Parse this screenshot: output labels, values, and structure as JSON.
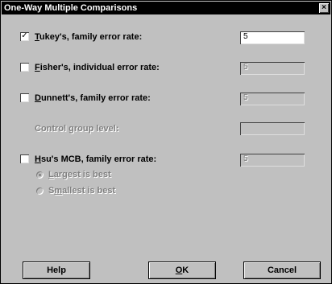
{
  "window": {
    "title": "One-Way Multiple Comparisons",
    "close_glyph": "×"
  },
  "options": {
    "tukey": {
      "prefix": "",
      "underline": "T",
      "rest": "ukey's, family error rate:",
      "checked": true,
      "value": "5"
    },
    "fisher": {
      "underline": "F",
      "rest": "isher's, individual error rate:",
      "checked": false,
      "value": "5"
    },
    "dunnett": {
      "underline": "D",
      "rest": "unnett's, family error rate:",
      "checked": false,
      "value": "5"
    },
    "control_group": {
      "label": "Control group level:",
      "value": ""
    },
    "hsu": {
      "underline": "H",
      "rest": "su's MCB, family error rate:",
      "checked": false,
      "value": "5"
    },
    "largest": {
      "underline": "L",
      "rest": "argest is best",
      "selected": true
    },
    "smallest": {
      "prefix": "S",
      "underline": "m",
      "rest": "allest is best",
      "selected": false
    }
  },
  "checkmark_glyph": "✓",
  "buttons": {
    "help": "Help",
    "ok_underline": "O",
    "ok_rest": "K",
    "cancel": "Cancel"
  }
}
